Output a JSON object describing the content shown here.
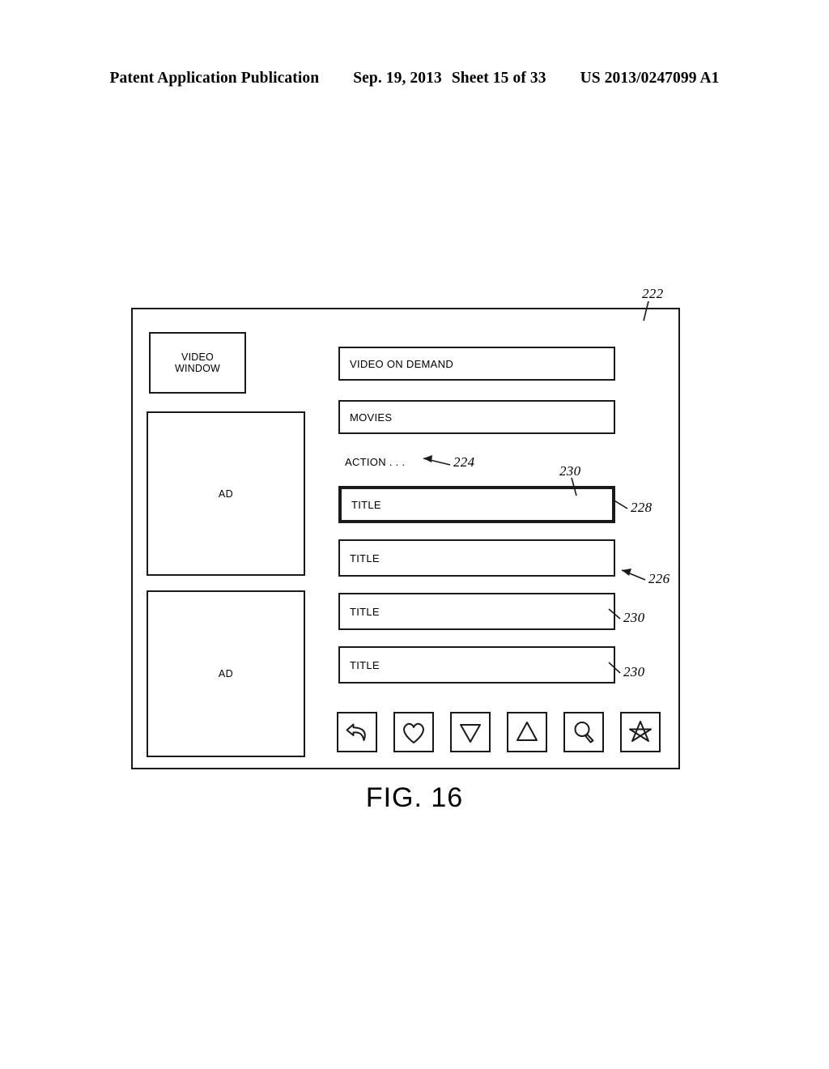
{
  "page_header": {
    "publication_label": "Patent Application Publication",
    "date": "Sep. 19, 2013",
    "sheet": "Sheet 15 of 33",
    "patent_number": "US 2013/0247099 A1"
  },
  "figure": {
    "caption": "FIG. 16",
    "screen_reference": "222",
    "video_window": {
      "label_line1": "VIDEO",
      "label_line2": "WINDOW"
    },
    "ads": [
      {
        "label": "AD"
      },
      {
        "label": "AD"
      }
    ],
    "menu_bars": [
      {
        "label": "VIDEO ON DEMAND"
      },
      {
        "label": "MOVIES"
      }
    ],
    "category": {
      "label": "ACTION . . .",
      "reference": "224"
    },
    "title_list": {
      "list_reference": "226",
      "rows": [
        {
          "label": "TITLE",
          "highlighted": true,
          "reference": "228",
          "secondary_reference": "230"
        },
        {
          "label": "TITLE",
          "highlighted": false,
          "reference": ""
        },
        {
          "label": "TITLE",
          "highlighted": false,
          "reference": "230"
        },
        {
          "label": "TITLE",
          "highlighted": false,
          "reference": "230"
        }
      ]
    },
    "toolbar_icons": [
      {
        "name": "back-arrow-icon"
      },
      {
        "name": "heart-icon"
      },
      {
        "name": "triangle-down-icon"
      },
      {
        "name": "triangle-up-icon"
      },
      {
        "name": "magnifier-icon"
      },
      {
        "name": "star-icon"
      }
    ],
    "colors": {
      "line": "#1a1a1a",
      "background": "#ffffff"
    }
  }
}
